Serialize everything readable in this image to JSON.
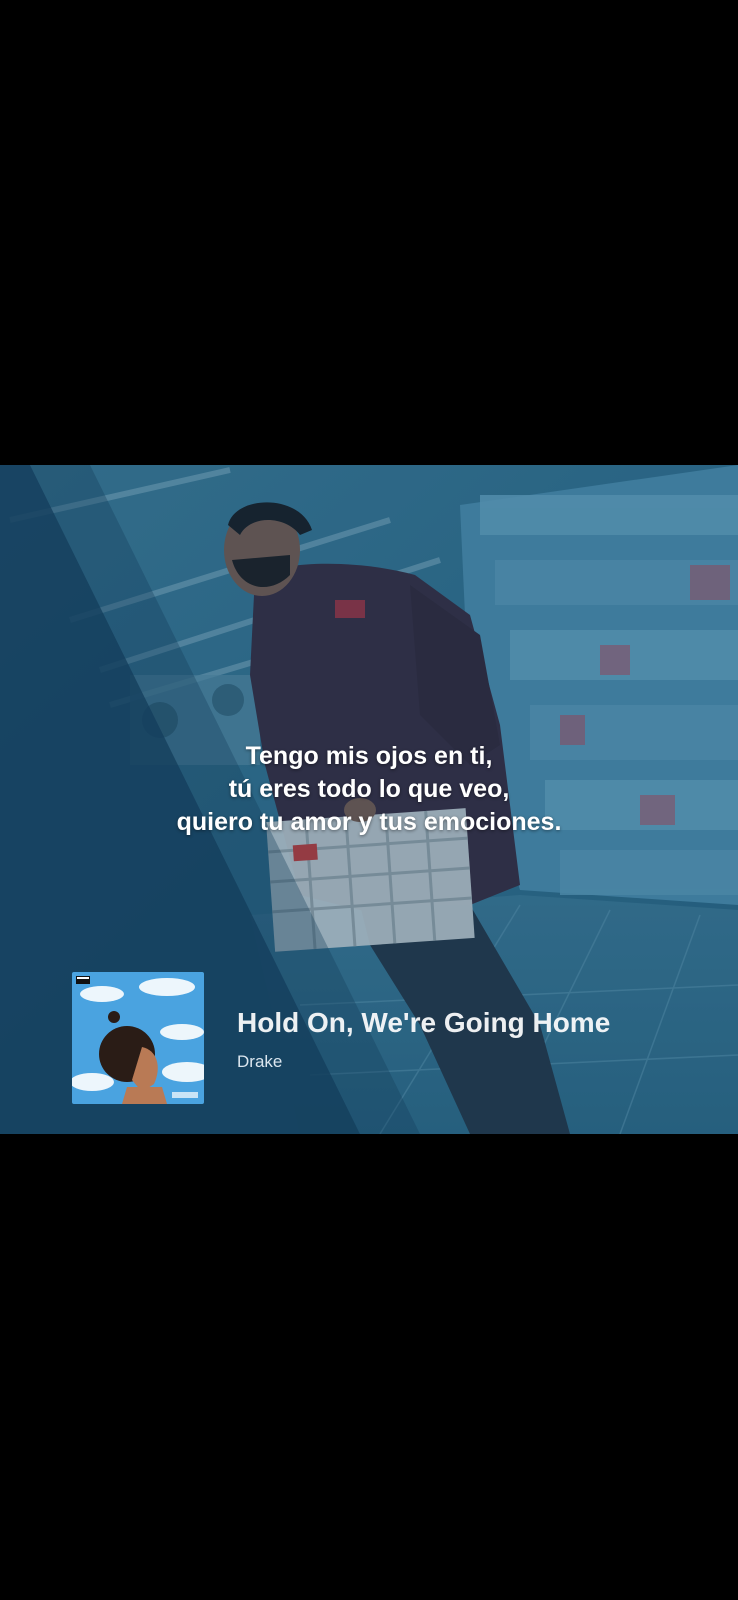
{
  "lyrics": {
    "lines": [
      "Tengo mis ojos en ti,",
      "tú eres todo lo que veo,",
      "quiero tu amor y tus emociones."
    ]
  },
  "track": {
    "title": "Hold On, We're Going Home",
    "artist": "Drake",
    "cover_icon": "album-cover-image"
  },
  "colors": {
    "page_background": "#000000",
    "card_tint": "#2a5f7e",
    "text": "#ffffff"
  }
}
